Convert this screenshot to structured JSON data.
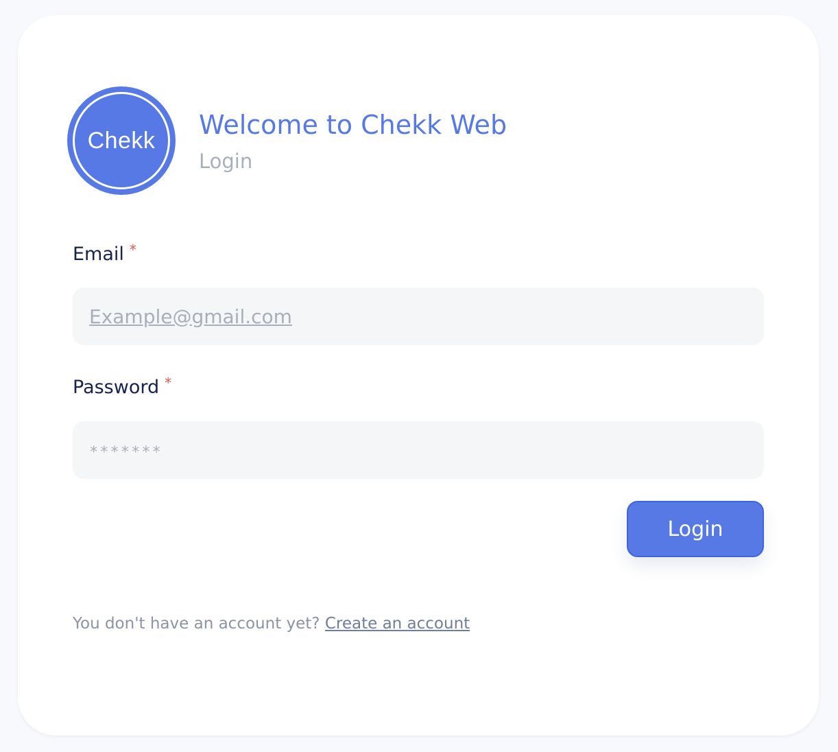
{
  "logo": {
    "text": "Chekk"
  },
  "header": {
    "title": "Welcome to Chekk Web",
    "subtitle": "Login"
  },
  "form": {
    "email": {
      "label": "Email",
      "required_mark": "*",
      "placeholder": "Example@gmail.com",
      "value": ""
    },
    "password": {
      "label": "Password",
      "required_mark": "*",
      "placeholder": "*******",
      "value": ""
    },
    "submit_label": "Login"
  },
  "footer": {
    "prompt": "You don't have an account yet?",
    "link_label": "Create an account"
  },
  "colors": {
    "accent": "#5679e5",
    "required": "#e0574f",
    "label": "#16234f",
    "muted": "#a9b0bd"
  }
}
